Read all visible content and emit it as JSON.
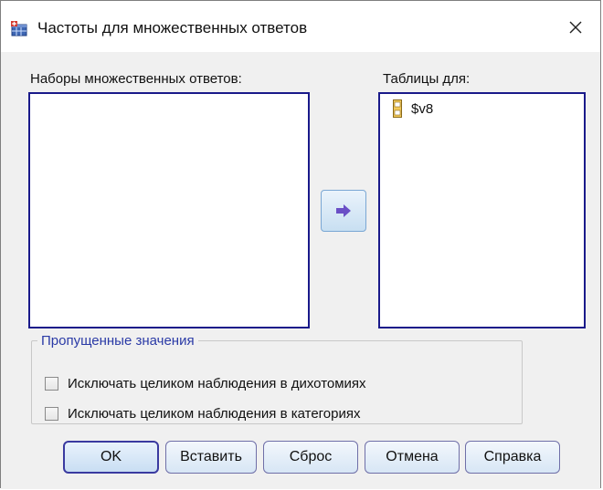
{
  "window": {
    "title": "Частоты для множественных ответов",
    "close_glyph": "✕",
    "icon": "spss-table-icon"
  },
  "sets_list": {
    "label": "Наборы множественных ответов:",
    "items": []
  },
  "tables_list": {
    "label": "Таблицы для:",
    "items": [
      {
        "icon": "variable-ruler-icon",
        "label": "$v8"
      }
    ]
  },
  "move_button": {
    "icon": "arrow-right-icon",
    "color": "#6a4fc6"
  },
  "missing_values": {
    "legend": "Пропущенные значения",
    "options": [
      {
        "label": "Исключать целиком наблюдения в дихотомиях",
        "checked": false
      },
      {
        "label": "Исключать целиком наблюдения в категориях",
        "checked": false
      }
    ]
  },
  "buttons": {
    "ok": "OK",
    "paste": "Вставить",
    "reset": "Сброс",
    "cancel": "Отмена",
    "help": "Справка"
  }
}
